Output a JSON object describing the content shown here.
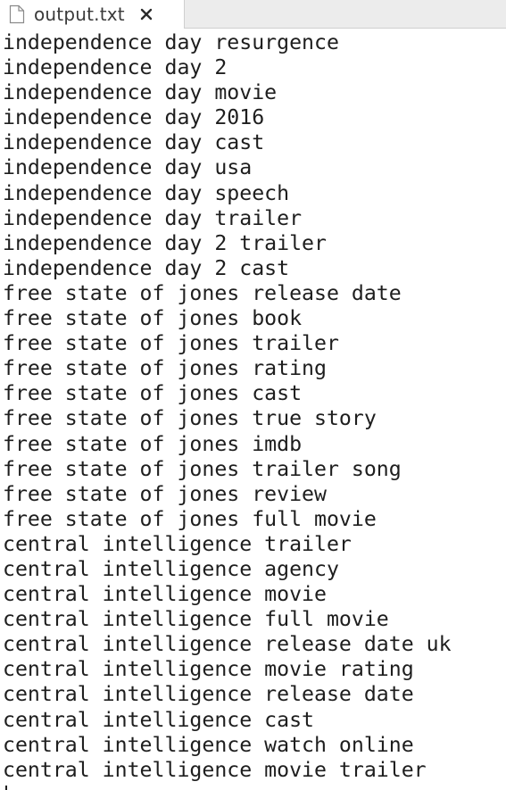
{
  "tab": {
    "filename": "output.txt",
    "icon": "file-icon",
    "close_icon": "close-icon"
  },
  "editor": {
    "lines": [
      "independence day resurgence",
      "independence day 2",
      "independence day movie",
      "independence day 2016",
      "independence day cast",
      "independence day usa",
      "independence day speech",
      "independence day trailer",
      "independence day 2 trailer",
      "independence day 2 cast",
      "free state of jones release date",
      "free state of jones book",
      "free state of jones trailer",
      "free state of jones rating",
      "free state of jones cast",
      "free state of jones true story",
      "free state of jones imdb",
      "free state of jones trailer song",
      "free state of jones review",
      "free state of jones full movie",
      "central intelligence trailer",
      "central intelligence agency",
      "central intelligence movie",
      "central intelligence full movie",
      "central intelligence release date uk",
      "central intelligence movie rating",
      "central intelligence release date",
      "central intelligence cast",
      "central intelligence watch online",
      "central intelligence movie trailer"
    ]
  }
}
